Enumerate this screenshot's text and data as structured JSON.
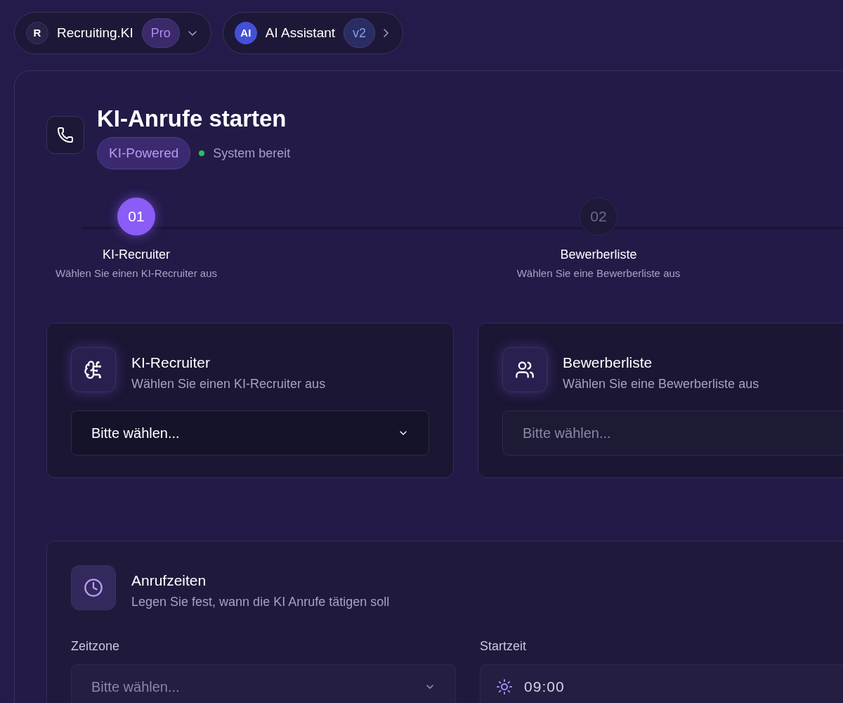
{
  "top_pills": [
    {
      "kind": "workspace",
      "avatar": "R",
      "label": "Recruiting.KI",
      "badge": "Pro"
    },
    {
      "kind": "assistant",
      "avatar": "AI",
      "label": "AI Assistant",
      "badge": "v2"
    }
  ],
  "header": {
    "title": "KI-Anrufe starten",
    "badge": "KI-Powered",
    "status": {
      "label": "System bereit",
      "color": "#22c55e"
    }
  },
  "steps": [
    {
      "number": "01",
      "title": "KI-Recruiter",
      "subtitle": "Wählen Sie einen KI-Recruiter aus",
      "selected": true
    },
    {
      "number": "02",
      "title": "Bewerberliste",
      "subtitle": "Wählen Sie eine Bewerberliste aus",
      "selected": false
    }
  ],
  "cards": [
    {
      "kind": "recruiter",
      "title": "KI-Recruiter",
      "subtitle": "Wählen Sie einen KI-Recruiter aus",
      "field": {
        "kind": "select",
        "value": "Bitte wählen..."
      }
    },
    {
      "kind": "list",
      "title": "Bewerberliste",
      "subtitle": "Wählen Sie eine Bewerberliste aus",
      "field": {
        "kind": "input",
        "placeholder": "Bitte wählen..."
      }
    }
  ],
  "call_times": {
    "title": "Anrufzeiten",
    "subtitle": "Legen Sie fest, wann die KI Anrufe tätigen soll",
    "fields": [
      {
        "label": "Zeitzone",
        "kind": "select",
        "placeholder": "Bitte wählen..."
      },
      {
        "label": "Startzeit",
        "kind": "time",
        "value": "09:00"
      }
    ]
  }
}
